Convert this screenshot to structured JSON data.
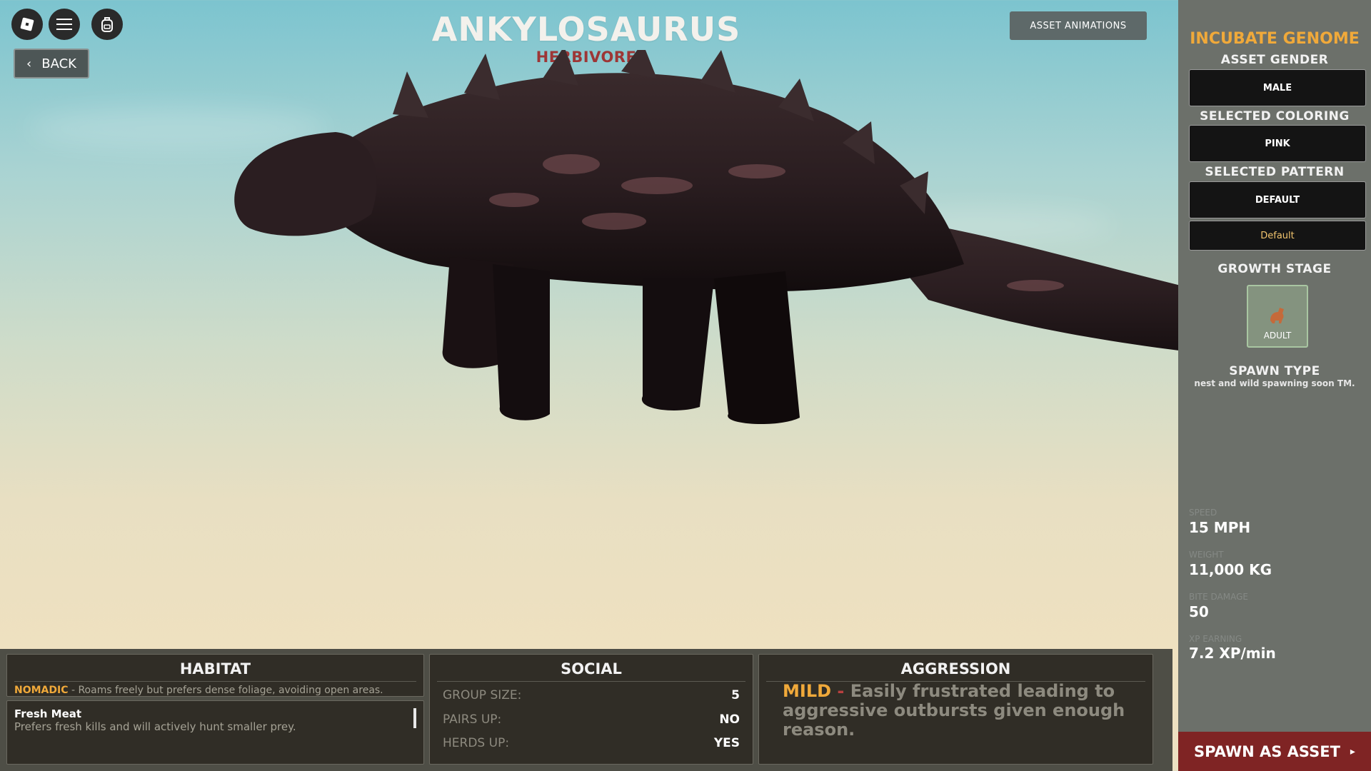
{
  "toolbar": {
    "back_label": "BACK",
    "back_chevron": "‹",
    "icons": [
      "roblox-logo-icon",
      "menu-icon",
      "backpack-icon"
    ]
  },
  "header": {
    "title": "ANKYLOSAURUS",
    "subtitle": "HERBIVORE",
    "animations_button": "ASSET ANIMATIONS"
  },
  "right_panel": {
    "title": "INCUBATE GENOME",
    "gender_label": "ASSET GENDER",
    "gender_value": "MALE",
    "coloring_label": "SELECTED COLORING",
    "coloring_value": "PINK",
    "pattern_label": "SELECTED PATTERN",
    "pattern_value": "DEFAULT",
    "pattern_option": "Default",
    "growth_label": "GROWTH STAGE",
    "growth_value": "ADULT",
    "spawn_type_label": "SPAWN TYPE",
    "spawn_type_note": "nest and wild spawning soon TM.",
    "stats": [
      {
        "name": "SPEED",
        "value": "15 MPH"
      },
      {
        "name": "WEIGHT",
        "value": "11,000 KG"
      },
      {
        "name": "BITE DAMAGE",
        "value": "50"
      },
      {
        "name": "XP EARNING",
        "value": "7.2 XP/min"
      }
    ],
    "spawn_button": "SPAWN AS ASSET",
    "spawn_arrow": "▸"
  },
  "habitat": {
    "title": "HABITAT",
    "type": "NOMADIC",
    "description": " - Roams freely but prefers dense foliage, avoiding open areas.",
    "diet_title": "Fresh Meat",
    "diet_description": "Prefers fresh kills and will actively hunt smaller prey."
  },
  "social": {
    "title": "SOCIAL",
    "rows": [
      {
        "key": "GROUP SIZE:",
        "value": "5"
      },
      {
        "key": "PAIRS UP:",
        "value": "NO"
      },
      {
        "key": "HERDS UP:",
        "value": "YES"
      }
    ]
  },
  "aggression": {
    "title": "AGGRESSION",
    "level": "MILD",
    "dash": " - ",
    "description": "Easily frustrated leading to aggressive outbursts given enough reason."
  },
  "colors": {
    "accent": "#f0a93a",
    "herbivore": "#9d3636",
    "spawn_button": "#7f2424"
  }
}
